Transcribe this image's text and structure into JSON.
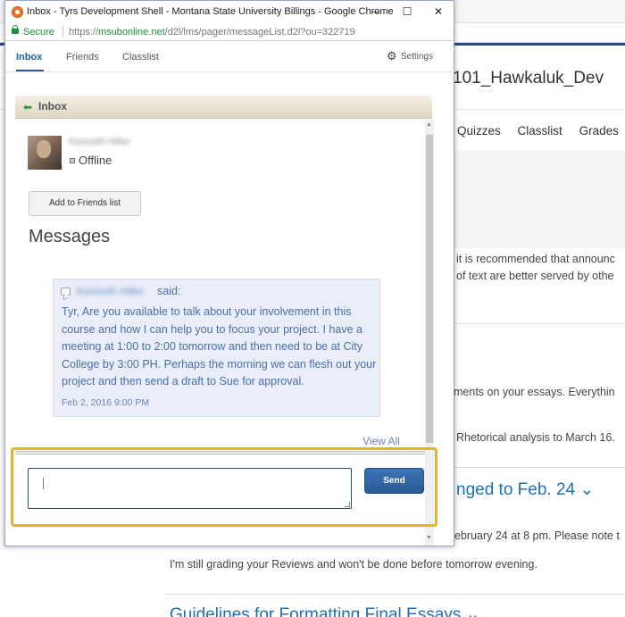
{
  "window": {
    "title": "Inbox - Tyrs Development Shell - Montana State University Billings - Google Chrome",
    "controls": {
      "minimize": "–",
      "maximize": "☐",
      "close": "✕"
    }
  },
  "address_bar": {
    "secure_label": "Secure",
    "url_scheme": "https://",
    "url_host": "msubonline.net",
    "url_path": "/d2l/lms/pager/messageList.d2l?ou=322719"
  },
  "tabs": [
    {
      "label": "Inbox",
      "active": true
    },
    {
      "label": "Friends",
      "active": false
    },
    {
      "label": "Classlist",
      "active": false
    }
  ],
  "settings_label": "Settings",
  "inbox_header": "Inbox",
  "contact": {
    "name": "Kenneth Hiller",
    "status": "Offline",
    "add_friend_label": "Add to Friends list"
  },
  "messages": {
    "title": "Messages",
    "items": [
      {
        "sender": "Kenneth Hiller",
        "said": "said:",
        "body": "Tyr, Are you available to talk about your involvement in this course and how I can help you to focus your project. I have a meeting at 1:00 to 2:00 tomorrow and then need to be at City College by 3:00 PH. Perhaps the morning we can flesh out your project and then send a draft to Sue for approval.",
        "date": "Feb 2, 2016 9:00 PM"
      }
    ],
    "view_all": "View All"
  },
  "compose": {
    "value": "",
    "send_label": "Send"
  },
  "background_page": {
    "course_title": "101_Hawkaluk_Dev",
    "nav": [
      "Quizzes",
      "Classlist",
      "Grades"
    ],
    "lines": [
      "it is recommended that announc",
      "of text are better served by othe",
      "ments on your essays. Everythin",
      "Rhetorical analysis to March 16.",
      "ebruary 24 at 8 pm. Please note t",
      "I'm still grading your Reviews and won't be done before tomorrow evening."
    ],
    "headings": [
      "nged to Feb. 24 ⌄",
      "Guidelines for Formatting Final Essays ⌄"
    ]
  },
  "colors": {
    "accent": "#1f5f9e",
    "highlight_border": "#e6b12b",
    "send_button": "#2b5a97",
    "message_bubble": "#eaeef8"
  }
}
